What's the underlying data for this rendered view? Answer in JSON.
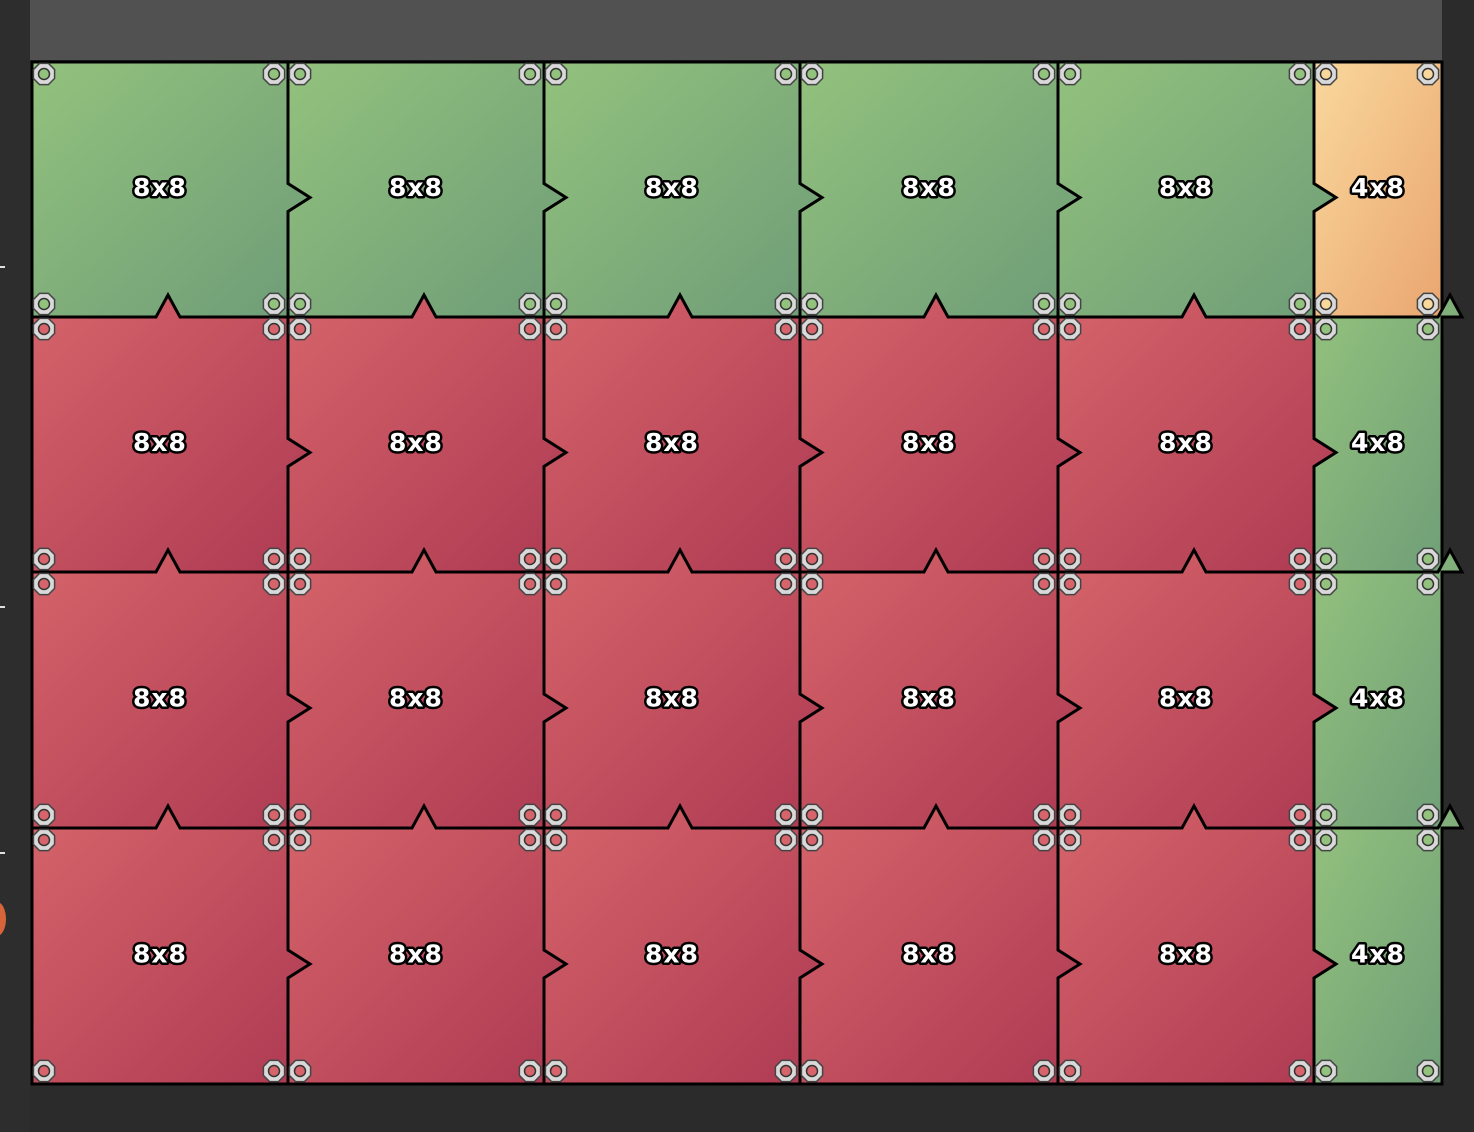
{
  "palette": {
    "green": [
      "#93c27d",
      "#6e9c78"
    ],
    "red": [
      "#d6646a",
      "#ad3a52"
    ],
    "orange": [
      "#f9d89c",
      "#eaa570"
    ],
    "bolt": "#d9d9d9",
    "outline": "#000000"
  },
  "grid": {
    "rows": [
      [
        {
          "label": "8x8",
          "color": "green"
        },
        {
          "label": "8x8",
          "color": "green"
        },
        {
          "label": "8x8",
          "color": "green"
        },
        {
          "label": "8x8",
          "color": "green"
        },
        {
          "label": "8x8",
          "color": "green"
        },
        {
          "label": "4x8",
          "color": "orange"
        }
      ],
      [
        {
          "label": "8x8",
          "color": "red"
        },
        {
          "label": "8x8",
          "color": "red"
        },
        {
          "label": "8x8",
          "color": "red"
        },
        {
          "label": "8x8",
          "color": "red"
        },
        {
          "label": "8x8",
          "color": "red"
        },
        {
          "label": "4x8",
          "color": "green"
        }
      ],
      [
        {
          "label": "8x8",
          "color": "red"
        },
        {
          "label": "8x8",
          "color": "red"
        },
        {
          "label": "8x8",
          "color": "red"
        },
        {
          "label": "8x8",
          "color": "red"
        },
        {
          "label": "8x8",
          "color": "red"
        },
        {
          "label": "4x8",
          "color": "green"
        }
      ],
      [
        {
          "label": "8x8",
          "color": "red"
        },
        {
          "label": "8x8",
          "color": "red"
        },
        {
          "label": "8x8",
          "color": "red"
        },
        {
          "label": "8x8",
          "color": "red"
        },
        {
          "label": "8x8",
          "color": "red"
        },
        {
          "label": "4x8",
          "color": "green"
        }
      ]
    ]
  }
}
